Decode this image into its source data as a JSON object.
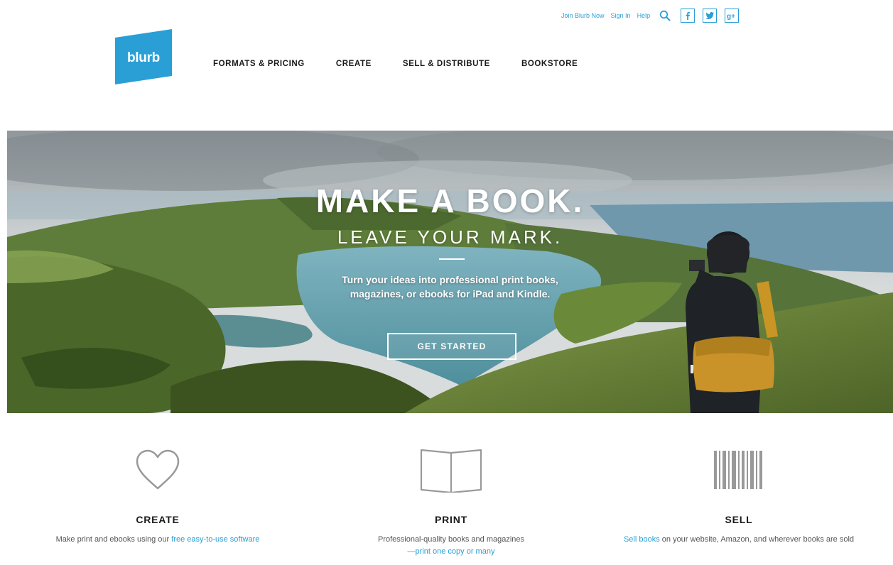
{
  "header": {
    "utility_links": [
      {
        "label": "Join Blurb Now"
      },
      {
        "label": "Sign In"
      },
      {
        "label": "Help"
      }
    ],
    "search_icon": "search-icon",
    "social": [
      {
        "icon": "facebook-icon",
        "glyph": "f"
      },
      {
        "icon": "twitter-icon",
        "glyph": "t"
      },
      {
        "icon": "google-plus-icon",
        "glyph": "g+"
      }
    ],
    "logo_text": "blurb",
    "nav": [
      {
        "label": "FORMATS & PRICING"
      },
      {
        "label": "CREATE"
      },
      {
        "label": "SELL & DISTRIBUTE"
      },
      {
        "label": "BOOKSTORE"
      }
    ]
  },
  "hero": {
    "title": "MAKE A BOOK.",
    "subtitle": "LEAVE YOUR MARK.",
    "body_line1": "Turn your ideas into professional print books,",
    "body_line2": "magazines, or ebooks for iPad and Kindle.",
    "cta": "GET STARTED"
  },
  "features": [
    {
      "icon": "heart-icon",
      "title": "CREATE",
      "desc_pre": "Make print and ebooks using our ",
      "desc_link": "free easy-to-use software",
      "desc_post": ""
    },
    {
      "icon": "open-book-icon",
      "title": "PRINT",
      "desc_pre": "Professional-quality books and magazines",
      "desc_link": "—print one copy or many",
      "desc_post": ""
    },
    {
      "icon": "barcode-icon",
      "title": "SELL",
      "desc_pre": "",
      "desc_link": "Sell books",
      "desc_post": " on your website, Amazon, and wherever books are sold"
    }
  ],
  "colors": {
    "brand_blue": "#2a9fd6",
    "text_dark": "#1a1a1a",
    "icon_gray": "#999999"
  }
}
